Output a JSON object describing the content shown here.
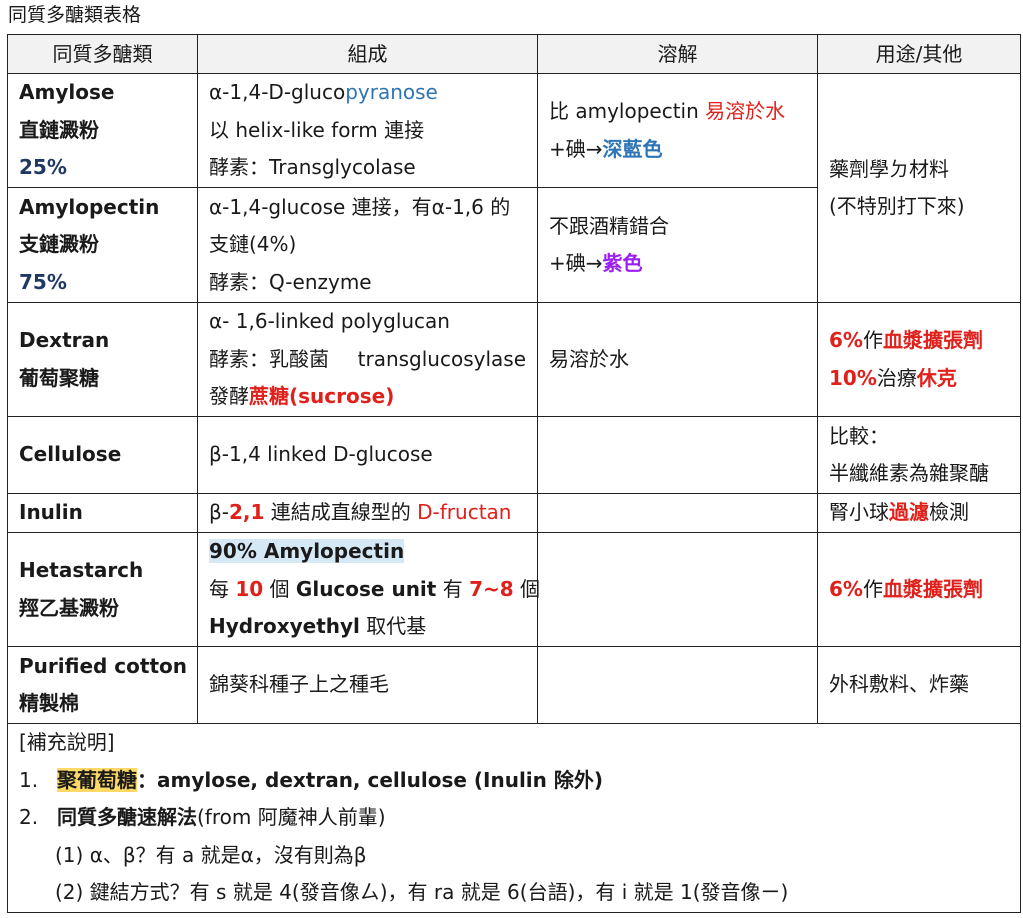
{
  "title": "同質多醣類表格",
  "headers": [
    "同質多醣類",
    "組成",
    "溶解",
    "用途/其他"
  ],
  "rows": {
    "amylose": {
      "name_en": "Amylose",
      "name_zh": "直鏈澱粉",
      "pct": "25%",
      "comp1_a": "α-1,4-D-gluco",
      "comp1_b": "pyranose",
      "comp2": "以 helix-like form 連接",
      "comp3": "酵素：Transglycolase",
      "sol1_a": "比 amylopectin ",
      "sol1_b": "易溶於水",
      "sol2_a": "+碘→",
      "sol2_b": "深藍色"
    },
    "amylopectin": {
      "name_en": "Amylopectin",
      "name_zh": "支鏈澱粉",
      "pct": "75%",
      "comp1": "α-1,4-glucose 連接，有α-1,6 的",
      "comp2": "支鏈(4%)",
      "comp3": "酵素：Q-enzyme",
      "sol1": "不跟酒精錯合",
      "sol2_a": "+碘→",
      "sol2_b": "紫色"
    },
    "starch_use": {
      "use1": "藥劑學ㄉ材料",
      "use2": "(不特別打下來)"
    },
    "dextran": {
      "name_en": "Dextran",
      "name_zh": "葡萄聚糖",
      "comp1": "α- 1,6-linked polyglucan",
      "comp2_a": "酵素：乳酸菌",
      "comp2_b": "transglucosylase",
      "comp3_a": "發酵",
      "comp3_b": "蔗糖(sucrose)",
      "sol": "易溶於水",
      "use1_a": "6%",
      "use1_b": "作",
      "use1_c": "血漿擴張劑",
      "use2_a": "10%",
      "use2_b": "治療",
      "use2_c": "休克"
    },
    "cellulose": {
      "name_en": "Cellulose",
      "comp": "β-1,4 linked D-glucose",
      "use1": "比較：",
      "use2": "半纖維素為雜聚醣"
    },
    "inulin": {
      "name_en": "Inulin",
      "comp_a": "β-",
      "comp_b": "2,1",
      "comp_c": " 連結成直線型的 ",
      "comp_d": "D-fructan",
      "use_a": "腎小球",
      "use_b": "過濾",
      "use_c": "檢測"
    },
    "hetastarch": {
      "name_en": "Hetastarch",
      "name_zh": "羥乙基澱粉",
      "comp1": "90% Amylopectin",
      "comp2_a": "每 ",
      "comp2_b": "10",
      "comp2_c": " 個 ",
      "comp2_d": "Glucose unit",
      "comp2_e": " 有 ",
      "comp2_f": "7~8",
      "comp2_g": " 個",
      "comp3_a": "Hydroxyethyl",
      "comp3_b": " 取代基",
      "use_a": "6%",
      "use_b": "作",
      "use_c": "血漿擴張劑"
    },
    "cotton": {
      "name_en": "Purified cotton",
      "name_zh": "精製棉",
      "comp": "錦葵科種子上之種毛",
      "use": "外科敷料、炸藥"
    }
  },
  "notes": {
    "heading": "[補充說明]",
    "item1_num": "1.",
    "item1_a": "聚葡萄糖",
    "item1_b": "：amylose, dextran, cellulose (Inulin 除外)",
    "item2_num": "2.",
    "item2_a": "同質多醣速解法",
    "item2_b": "(from 阿魔神人前輩)",
    "sub1": "(1)  α、β？有 a 就是α，沒有則為β",
    "sub2": "(2)  鍵結方式？有 s 就是 4(發音像ㄙ)，有 ra 就是 6(台語)，有 i 就是 1(發音像ㄧ)"
  },
  "colors": {
    "red": "#e0201b",
    "blue": "#2e75b6",
    "navy": "#1f3864",
    "purple": "#9b1ff0",
    "highlight_blue": "#d5e8f6",
    "highlight_yellow": "#ffd966"
  }
}
